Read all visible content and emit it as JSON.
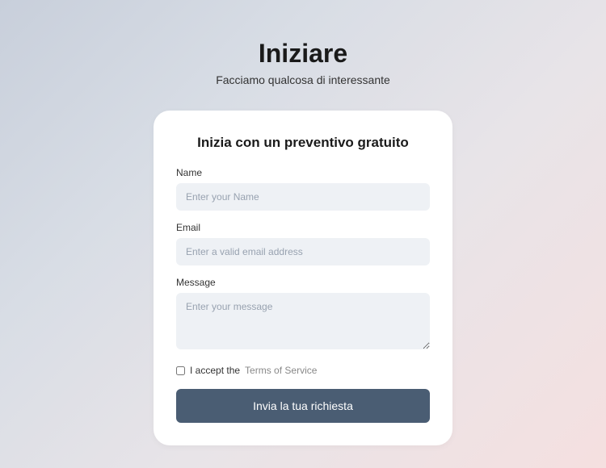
{
  "header": {
    "title": "Iniziare",
    "subtitle": "Facciamo qualcosa di interessante"
  },
  "card": {
    "title": "Inizia con un preventivo gratuito",
    "fields": {
      "name": {
        "label": "Name",
        "placeholder": "Enter your Name"
      },
      "email": {
        "label": "Email",
        "placeholder": "Enter a valid email address"
      },
      "message": {
        "label": "Message",
        "placeholder": "Enter your message"
      }
    },
    "terms": {
      "prefix": "I accept the ",
      "link": "Terms of Service"
    },
    "submit": "Invia la tua richiesta"
  }
}
